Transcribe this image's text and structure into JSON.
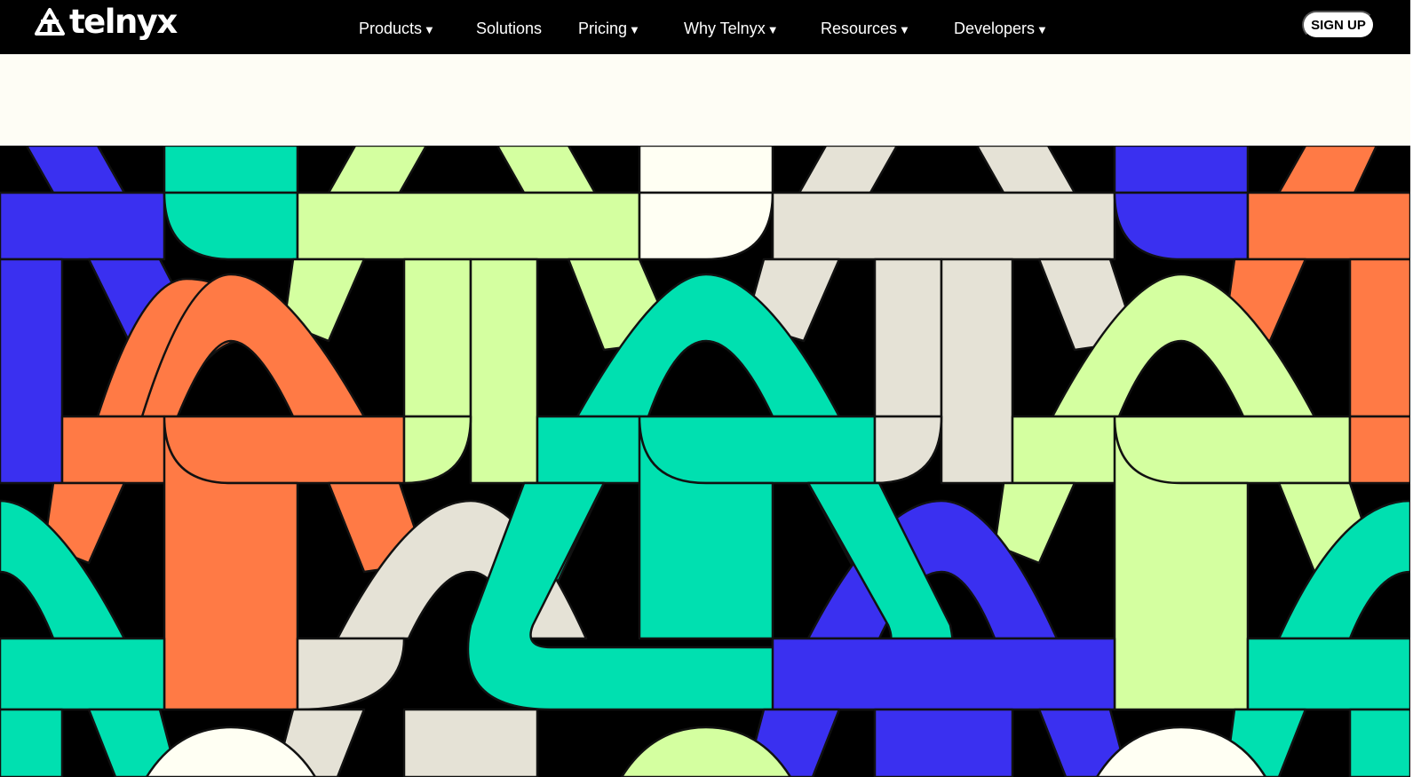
{
  "brand": {
    "name": "telnyx"
  },
  "nav": {
    "items": [
      {
        "label": "Products",
        "caret": "▼"
      },
      {
        "label": "Solutions",
        "caret": ""
      },
      {
        "label": "Pricing",
        "caret": "▼"
      },
      {
        "label": "Why Telnyx",
        "caret": "▼"
      },
      {
        "label": "Resources",
        "caret": "▼"
      },
      {
        "label": "Developers",
        "caret": "▼"
      }
    ],
    "signup_label": "SIGN UP"
  },
  "icons": {
    "logo": "telnyx-logo-icon",
    "dropdown": "chevron-down-icon"
  },
  "colors": {
    "nav_bg": "#000000",
    "page_bg": "#fefdf5",
    "pattern_blue": "#3a30f0",
    "pattern_green": "#00e0b0",
    "pattern_orange": "#ff7a45",
    "pattern_lime": "#d4ffa0",
    "pattern_beige": "#e5e2d6",
    "pattern_white": "#fffff3"
  }
}
